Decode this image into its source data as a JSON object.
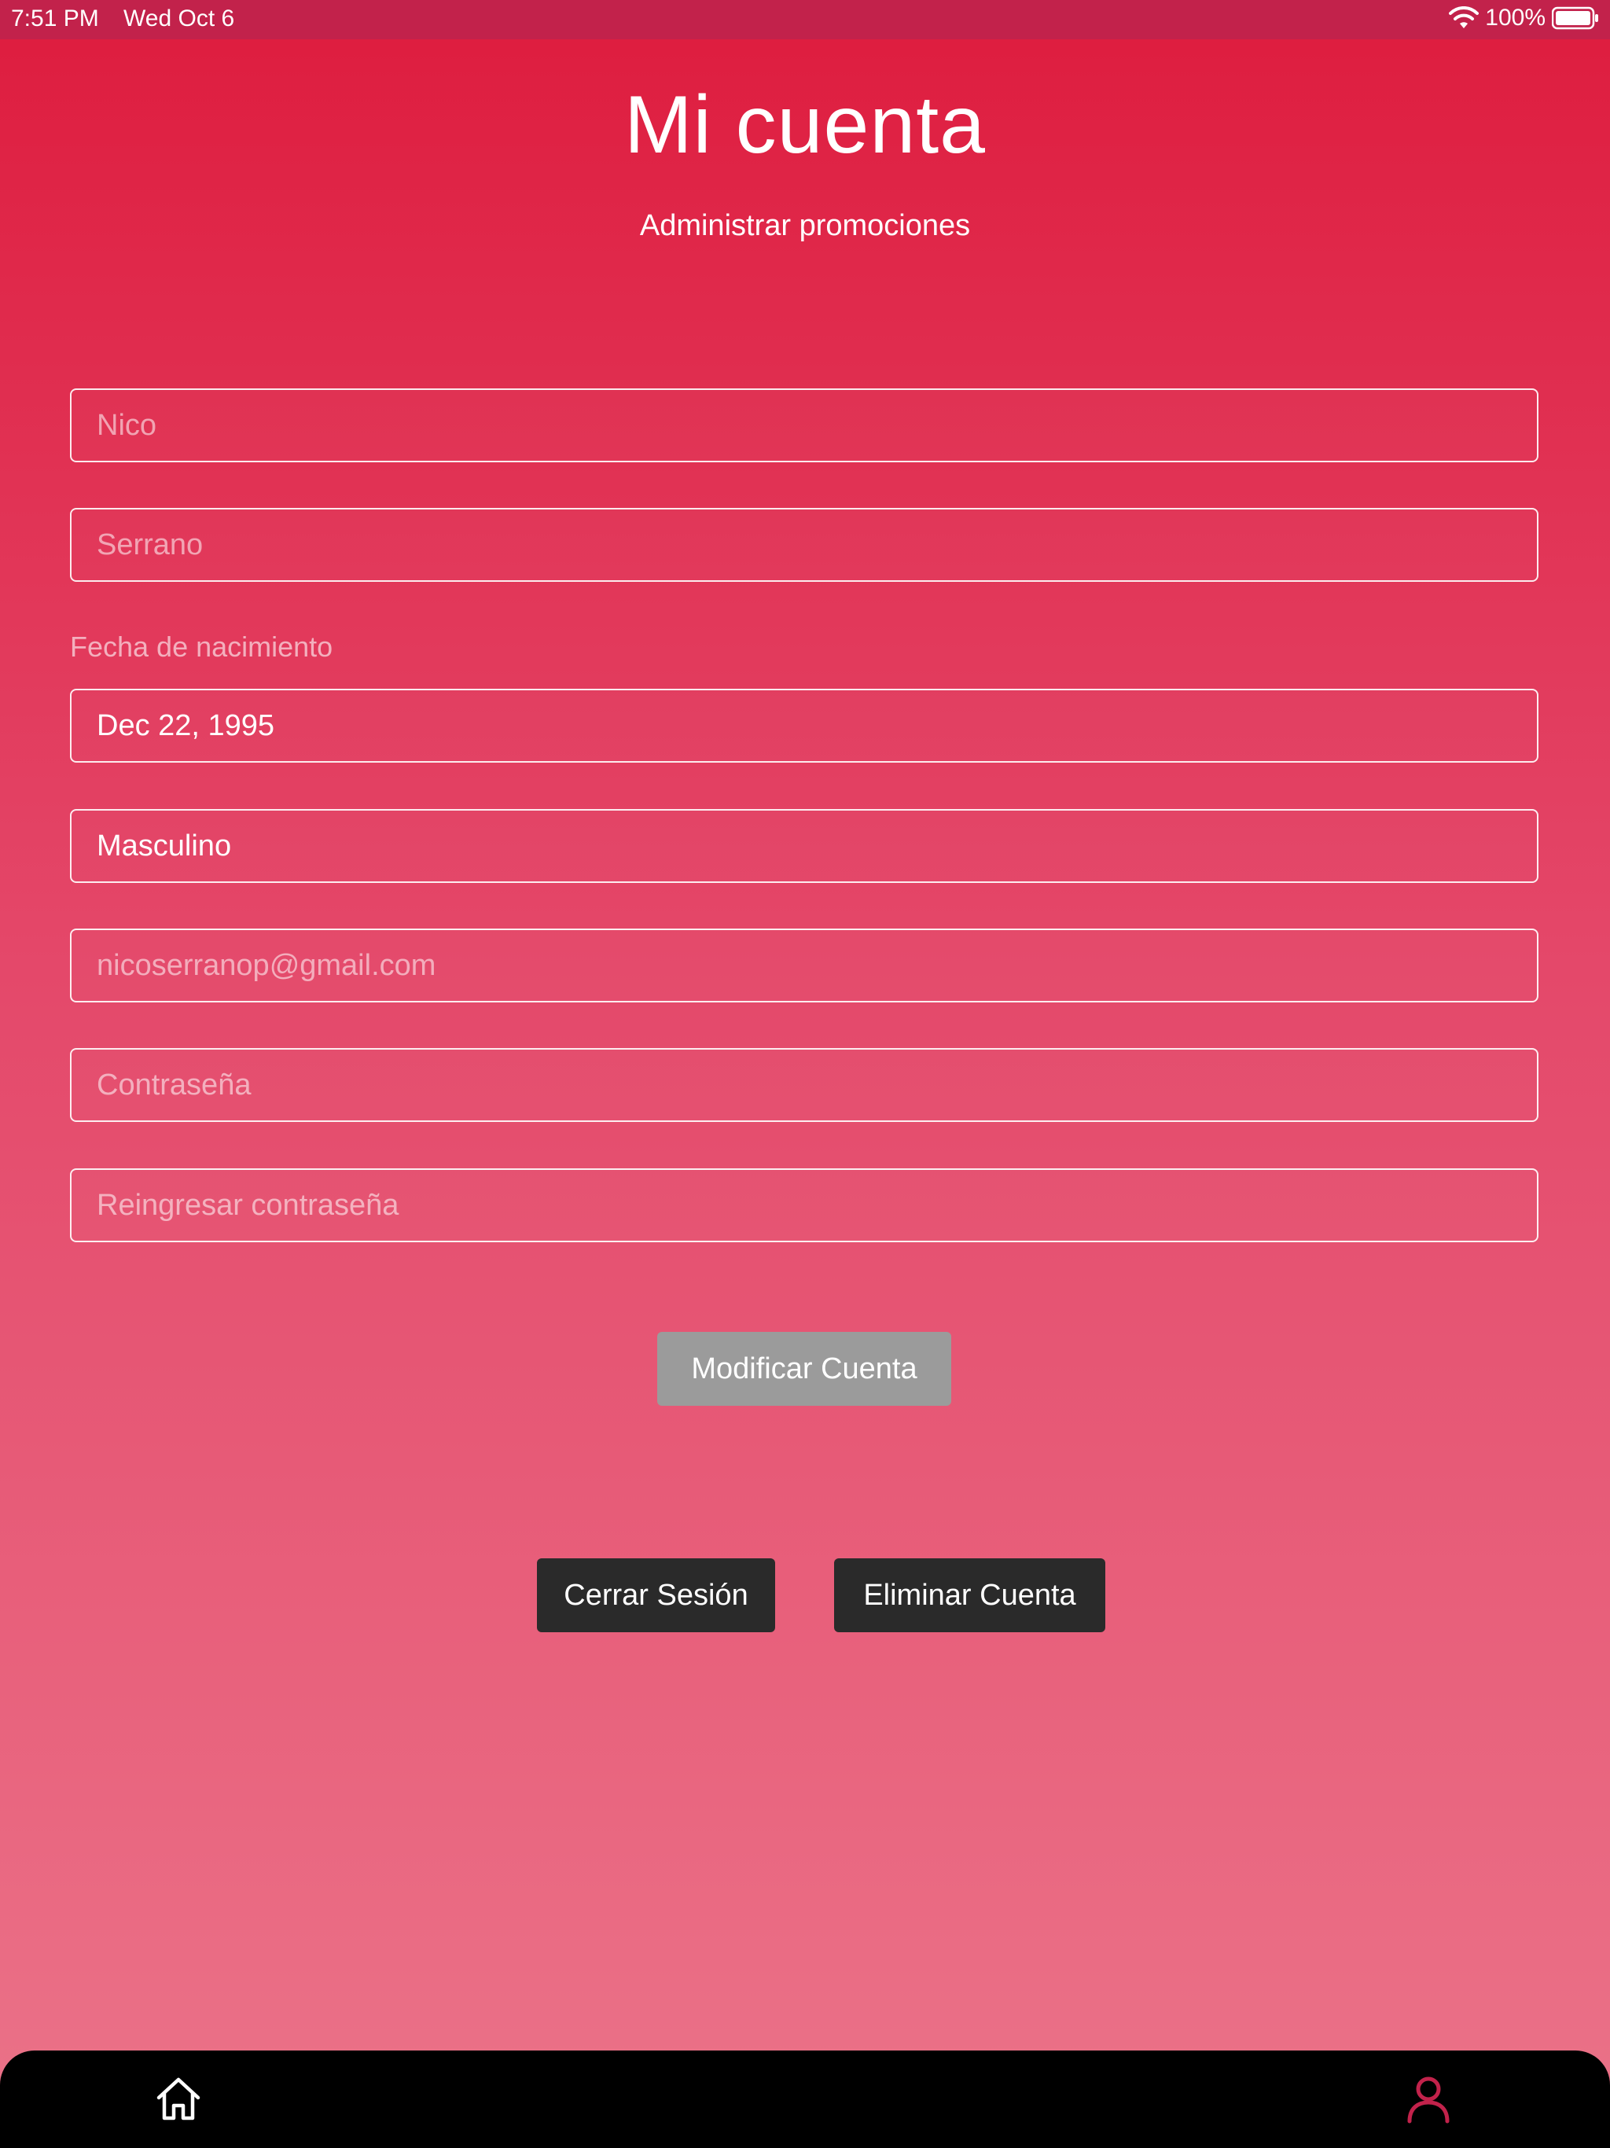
{
  "status_bar": {
    "time": "7:51 PM",
    "date": "Wed Oct 6",
    "battery": "100%"
  },
  "header": {
    "title": "Mi cuenta",
    "subtitle": "Administrar promociones"
  },
  "form": {
    "first_name": {
      "placeholder": "Nico"
    },
    "last_name": {
      "placeholder": "Serrano"
    },
    "birthdate_label": "Fecha de nacimiento",
    "birthdate_value": "Dec 22, 1995",
    "gender_value": "Masculino",
    "email": {
      "placeholder": "nicoserranop@gmail.com"
    },
    "password": {
      "placeholder": "Contraseña"
    },
    "password_confirm": {
      "placeholder": "Reingresar contraseña"
    }
  },
  "buttons": {
    "modify": "Modificar Cuenta",
    "logout": "Cerrar Sesión",
    "delete": "Eliminar Cuenta"
  },
  "nav": {
    "items": [
      {
        "icon": "home-icon",
        "active": false
      },
      {
        "icon": "user-icon",
        "active": true
      }
    ],
    "active_color": "#c2224b"
  },
  "colors": {
    "gradient_top": "#de1c3e",
    "gradient_bottom": "#eb7389",
    "status_bar": "#c2224b",
    "disabled_button": "#9b9b9b",
    "dark_button": "#2a2a2a"
  }
}
